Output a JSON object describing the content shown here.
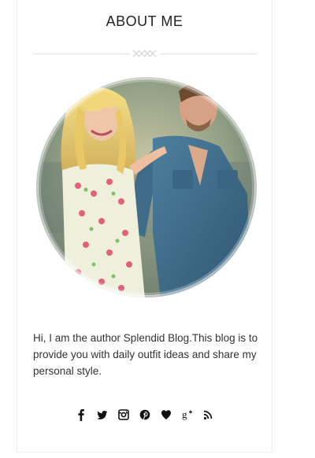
{
  "widget": {
    "title": "ABOUT ME",
    "bio": "Hi, I am the author Splendid Blog.This blog is to provide you with daily outfit ideas and share my personal style."
  },
  "social": [
    {
      "name": "facebook-icon"
    },
    {
      "name": "twitter-icon"
    },
    {
      "name": "instagram-icon"
    },
    {
      "name": "pinterest-icon"
    },
    {
      "name": "heart-icon"
    },
    {
      "name": "google-plus-icon"
    },
    {
      "name": "rss-icon"
    }
  ],
  "colors": {
    "text": "#222222",
    "border": "#ececec",
    "divider": "#e2e2e2"
  }
}
